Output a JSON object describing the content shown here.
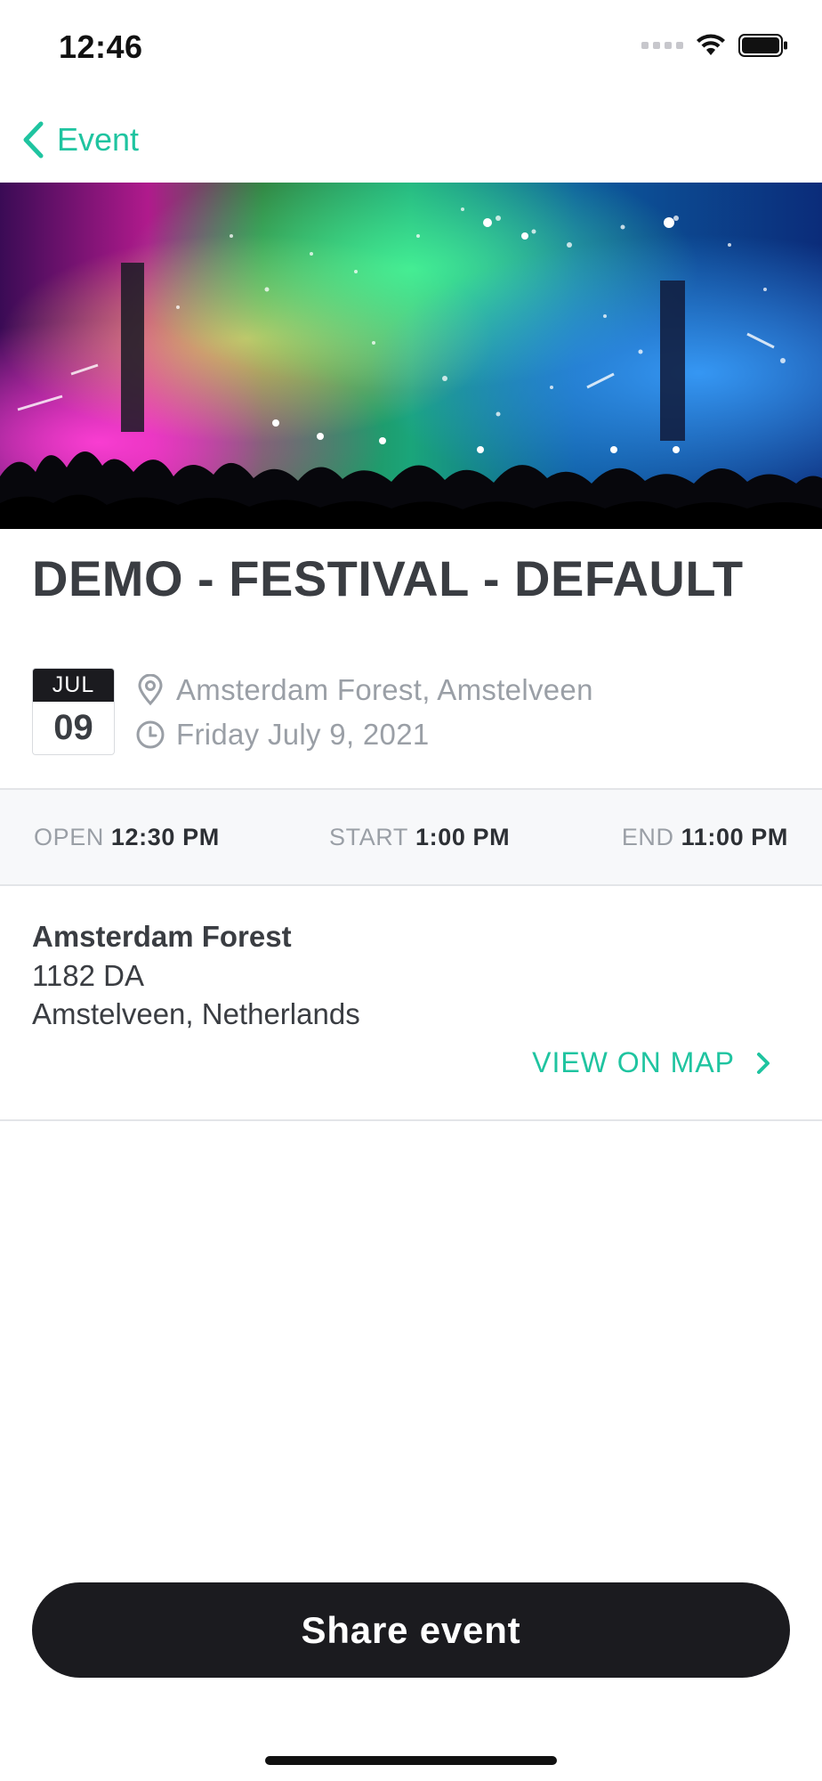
{
  "status_bar": {
    "time": "12:46"
  },
  "nav": {
    "back_label": "Event"
  },
  "event": {
    "title": "DEMO - FESTIVAL - DEFAULT",
    "date_badge": {
      "month": "JUL",
      "day": "09"
    },
    "location": "Amsterdam Forest, Amstelveen",
    "date_text": "Friday July 9, 2021",
    "times": {
      "open": {
        "label": "OPEN",
        "value": "12:30 PM"
      },
      "start": {
        "label": "START",
        "value": "1:00 PM"
      },
      "end": {
        "label": "END",
        "value": "11:00 PM"
      }
    }
  },
  "venue": {
    "name": "Amsterdam Forest",
    "postal_code": "1182 DA",
    "city_country": "Amstelveen, Netherlands",
    "map_link_label": "VIEW ON MAP"
  },
  "actions": {
    "share_label": "Share event"
  },
  "colors": {
    "accent": "#1fc4a0",
    "dark": "#1b1b1f",
    "text": "#3a3d42",
    "muted": "#9a9fa6"
  },
  "icons": {
    "back": "chevron-left-icon",
    "location": "location-pin-icon",
    "clock": "clock-icon",
    "map_chevron": "chevron-right-icon"
  }
}
